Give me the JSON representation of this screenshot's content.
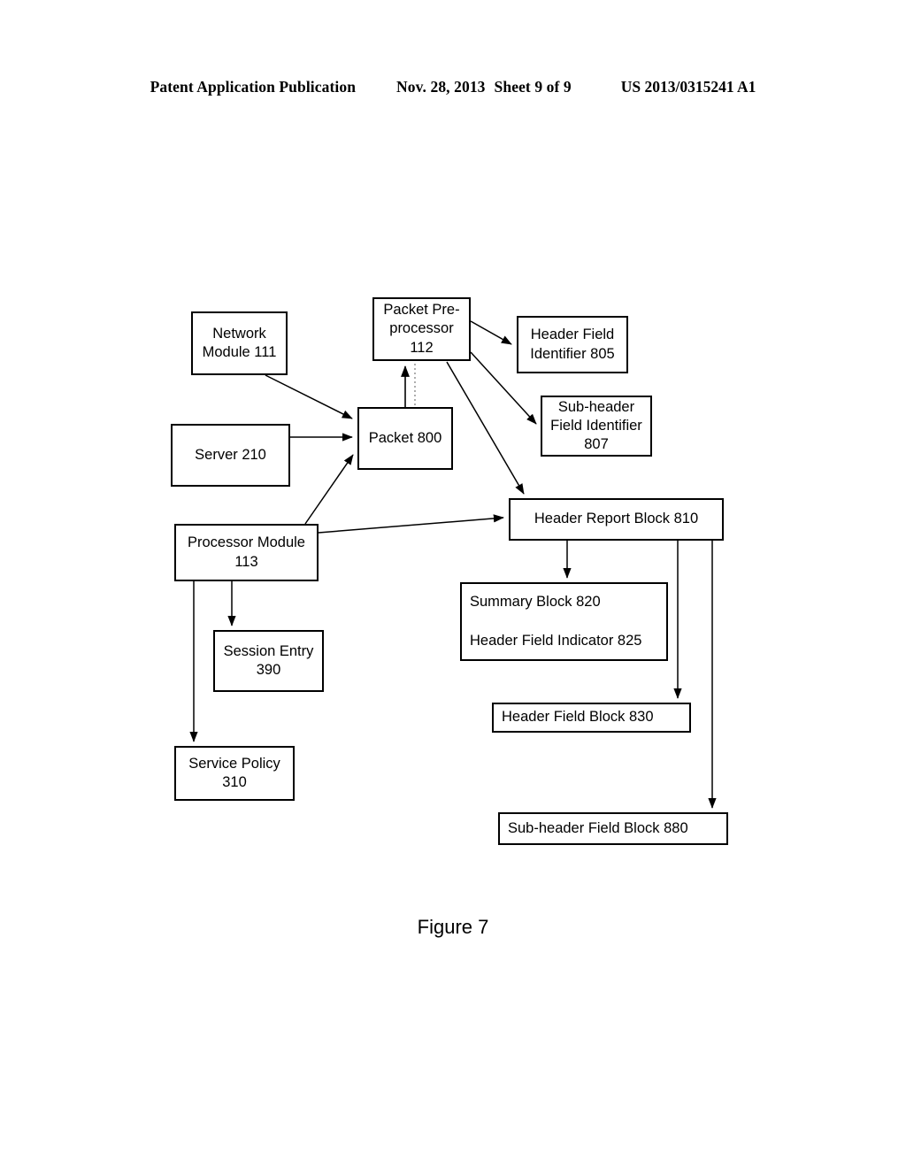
{
  "page_header": {
    "publication": "Patent Application Publication",
    "date": "Nov. 28, 2013",
    "sheet": "Sheet 9 of 9",
    "number": "US 2013/0315241 A1"
  },
  "figure": {
    "caption": "Figure 7"
  },
  "diagram": {
    "type": "block-diagram",
    "nodes": [
      {
        "id": "network_module",
        "label": "Network\nModule 111"
      },
      {
        "id": "packet_preprocessor",
        "label": "Packet Pre-\nprocessor\n112"
      },
      {
        "id": "header_field_identifier",
        "label": "Header Field\nIdentifier 805"
      },
      {
        "id": "subheader_field_identifier",
        "label": "Sub-header\nField Identifier\n807"
      },
      {
        "id": "server",
        "label": "Server 210"
      },
      {
        "id": "packet",
        "label": "Packet 800"
      },
      {
        "id": "processor_module",
        "label": "Processor Module\n113"
      },
      {
        "id": "header_report_block",
        "label": "Header Report Block 810"
      },
      {
        "id": "summary_block_line1",
        "label": "Summary Block 820"
      },
      {
        "id": "summary_block_line2",
        "label": "Header Field Indicator 825"
      },
      {
        "id": "session_entry",
        "label": "Session Entry\n390"
      },
      {
        "id": "header_field_block",
        "label": "Header Field Block 830"
      },
      {
        "id": "service_policy",
        "label": "Service Policy\n310"
      },
      {
        "id": "subheader_field_block",
        "label": "Sub-header Field Block 880"
      }
    ],
    "edges": [
      {
        "from": "network_module",
        "to": "packet",
        "style": "solid"
      },
      {
        "from": "server",
        "to": "packet",
        "style": "solid"
      },
      {
        "from": "processor_module",
        "to": "packet",
        "style": "solid"
      },
      {
        "from": "packet",
        "to": "packet_preprocessor",
        "style": "solid"
      },
      {
        "from": "packet",
        "to": "packet_preprocessor",
        "style": "dotted"
      },
      {
        "from": "packet_preprocessor",
        "to": "header_field_identifier",
        "style": "solid"
      },
      {
        "from": "packet_preprocessor",
        "to": "subheader_field_identifier",
        "style": "solid"
      },
      {
        "from": "packet_preprocessor",
        "to": "header_report_block",
        "style": "solid"
      },
      {
        "from": "processor_module",
        "to": "header_report_block",
        "style": "solid"
      },
      {
        "from": "header_report_block",
        "to": "summary_block",
        "style": "solid"
      },
      {
        "from": "header_report_block",
        "to": "header_field_block",
        "style": "solid"
      },
      {
        "from": "header_report_block",
        "to": "subheader_field_block",
        "style": "solid"
      },
      {
        "from": "processor_module",
        "to": "session_entry",
        "style": "solid"
      },
      {
        "from": "processor_module",
        "to": "service_policy",
        "style": "solid"
      }
    ],
    "colors": {
      "stroke": "#000000",
      "background": "#ffffff"
    }
  }
}
